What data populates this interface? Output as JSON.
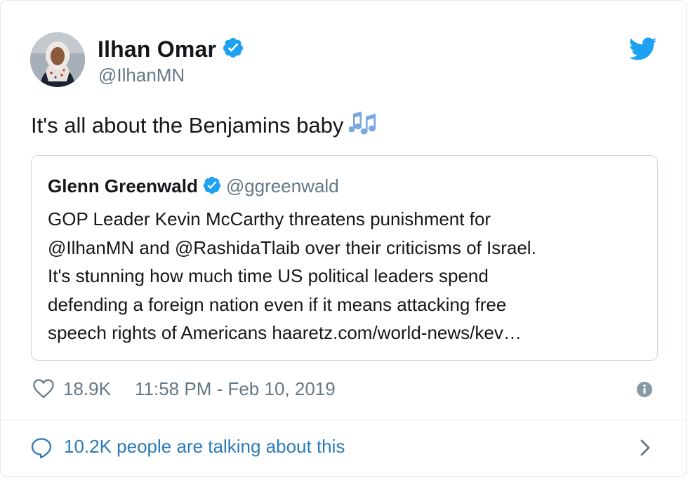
{
  "author": {
    "name": "Ilhan Omar",
    "handle": "@IlhanMN",
    "verified": true
  },
  "tweet": {
    "text": "It's all about the Benjamins baby",
    "emoji_icon": "musical-notes-icon"
  },
  "quoted": {
    "name": "Glenn Greenwald",
    "handle": "@ggreenwald",
    "verified": true,
    "lines": [
      "GOP Leader Kevin McCarthy threatens punishment for",
      "@IlhanMN and @RashidaTlaib over their criticisms of Israel.",
      "It's stunning how much time US political leaders spend",
      "defending a foreign nation even if it means attacking free",
      "speech rights of Americans haaretz.com/world-news/kev…"
    ]
  },
  "meta": {
    "likes": "18.9K",
    "timestamp": "11:58 PM - Feb 10, 2019"
  },
  "footer": {
    "talking": "10.2K people are talking about this"
  },
  "colors": {
    "verified_blue": "#1da1f2",
    "link_blue": "#2b7bb9",
    "secondary_gray": "#657786",
    "border": "#e1e8ed"
  }
}
